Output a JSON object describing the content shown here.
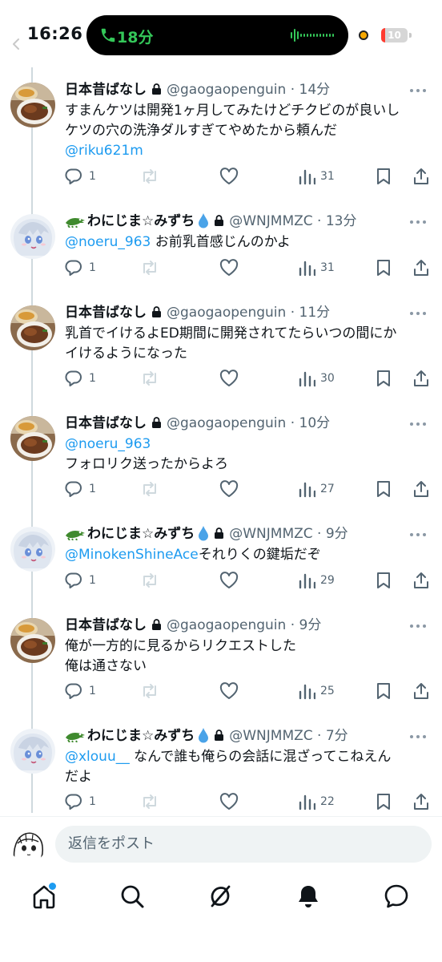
{
  "status_bar": {
    "time": "16:26",
    "call_duration": "18分",
    "battery_level": "10",
    "colors": {
      "call": "#34c759",
      "battery_low": "#ff3b30",
      "recording": "#f7a800"
    }
  },
  "colors": {
    "link": "#1d9bf0",
    "secondary_text": "#536471",
    "primary_text": "#0f1419",
    "thread_line": "#cfd9de"
  },
  "tweets": [
    {
      "display_name": "日本昔ばなし",
      "handle_time": "@gaogaopenguin · 14分",
      "body_lines": [
        {
          "text": "すまんケツは開発1ヶ月してみたけどチクビのが良いし",
          "mention": false
        },
        {
          "text": "ケツの穴の洗浄ダルすぎてやめたから頼んだ",
          "mention": false
        },
        {
          "text": "@riku621m",
          "mention": true
        }
      ],
      "reply_count": "1",
      "view_count": "31"
    },
    {
      "display_name": "わにじま☆みずち",
      "handle_time": "@WNJMMZC · 13分",
      "body_lines": [
        {
          "mention_text": "@noeru_963",
          "text": " お前乳首感じんのかよ"
        }
      ],
      "reply_count": "1",
      "view_count": "31"
    },
    {
      "display_name": "日本昔ばなし",
      "handle_time": "@gaogaopenguin · 11分",
      "body_lines": [
        {
          "text": "乳首でイけるよED期間に開発されてたらいつの間にか",
          "mention": false
        },
        {
          "text": "イけるようになった",
          "mention": false
        }
      ],
      "reply_count": "1",
      "view_count": "30"
    },
    {
      "display_name": "日本昔ばなし",
      "handle_time": "@gaogaopenguin · 10分",
      "body_lines": [
        {
          "text": "@noeru_963",
          "mention": true
        },
        {
          "text": "フォロリク送ったからよろ",
          "mention": false
        }
      ],
      "reply_count": "1",
      "view_count": "27"
    },
    {
      "display_name": "わにじま☆みずち",
      "handle_time": "@WNJMMZC · 9分",
      "body_lines": [
        {
          "mention_text": "@MinokenShineAce",
          "text": "それりくの鍵垢だぞ"
        }
      ],
      "reply_count": "1",
      "view_count": "29"
    },
    {
      "display_name": "日本昔ばなし",
      "handle_time": "@gaogaopenguin · 9分",
      "body_lines": [
        {
          "text": "俺が一方的に見るからリクエストした",
          "mention": false
        },
        {
          "text": "俺は通さない",
          "mention": false
        }
      ],
      "reply_count": "1",
      "view_count": "25"
    },
    {
      "display_name": "わにじま☆みずち",
      "handle_time": "@WNJMMZC · 7分",
      "body_lines": [
        {
          "mention_text": "@xlouu__",
          "text": " なんで誰も俺らの会話に混ざってこねえん"
        },
        {
          "text": "だよ",
          "mention": false
        }
      ],
      "reply_count": "1",
      "view_count": "22"
    }
  ],
  "reply_bar": {
    "placeholder": "返信をポスト"
  },
  "tab_bar": {
    "items": [
      "home-icon",
      "search-icon",
      "grok-icon",
      "notifications-icon",
      "messages-icon"
    ]
  }
}
